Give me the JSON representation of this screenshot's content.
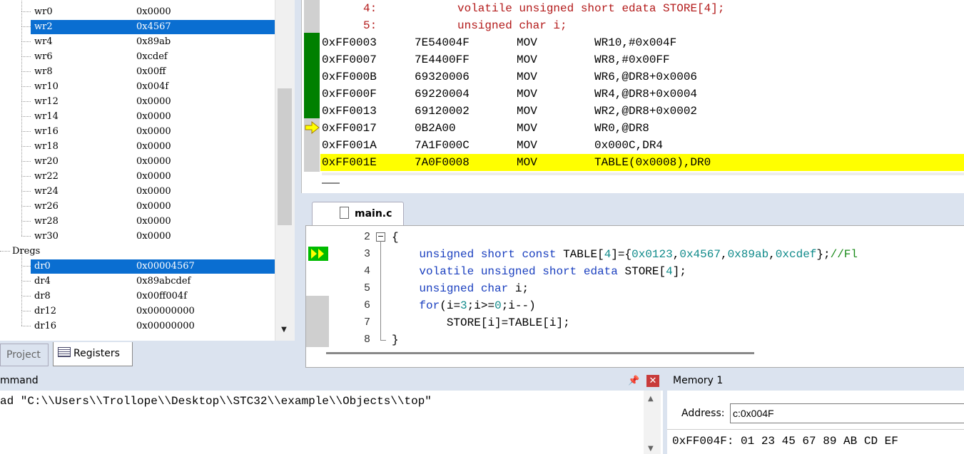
{
  "registers": {
    "wregs": [
      {
        "name": "wr0",
        "value": "0x0000"
      },
      {
        "name": "wr2",
        "value": "0x4567",
        "selected": true
      },
      {
        "name": "wr4",
        "value": "0x89ab"
      },
      {
        "name": "wr6",
        "value": "0xcdef"
      },
      {
        "name": "wr8",
        "value": "0x00ff"
      },
      {
        "name": "wr10",
        "value": "0x004f"
      },
      {
        "name": "wr12",
        "value": "0x0000"
      },
      {
        "name": "wr14",
        "value": "0x0000"
      },
      {
        "name": "wr16",
        "value": "0x0000"
      },
      {
        "name": "wr18",
        "value": "0x0000"
      },
      {
        "name": "wr20",
        "value": "0x0000"
      },
      {
        "name": "wr22",
        "value": "0x0000"
      },
      {
        "name": "wr24",
        "value": "0x0000"
      },
      {
        "name": "wr26",
        "value": "0x0000"
      },
      {
        "name": "wr28",
        "value": "0x0000"
      },
      {
        "name": "wr30",
        "value": "0x0000"
      }
    ],
    "dregs_label": "Dregs",
    "dregs": [
      {
        "name": "dr0",
        "value": "0x00004567",
        "selected": true
      },
      {
        "name": "dr4",
        "value": "0x89abcdef"
      },
      {
        "name": "dr8",
        "value": "0x00ff004f"
      },
      {
        "name": "dr12",
        "value": "0x00000000"
      },
      {
        "name": "dr16",
        "value": "0x00000000"
      }
    ]
  },
  "tabs": {
    "project": "Project",
    "registers": "Registers"
  },
  "disassembly": {
    "source": [
      {
        "num": "4:",
        "text": "volatile unsigned short edata STORE[4];"
      },
      {
        "num": "5:",
        "text": "unsigned char i;"
      }
    ],
    "lines": [
      {
        "addr": "0xFF0003",
        "bytes": "7E54004F",
        "op": "MOV",
        "args": "WR10,#0x004F"
      },
      {
        "addr": "0xFF0007",
        "bytes": "7E4400FF",
        "op": "MOV",
        "args": "WR8,#0x00FF"
      },
      {
        "addr": "0xFF000B",
        "bytes": "69320006",
        "op": "MOV",
        "args": "WR6,@DR8+0x0006"
      },
      {
        "addr": "0xFF000F",
        "bytes": "69220004",
        "op": "MOV",
        "args": "WR4,@DR8+0x0004"
      },
      {
        "addr": "0xFF0013",
        "bytes": "69120002",
        "op": "MOV",
        "args": "WR2,@DR8+0x0002"
      },
      {
        "addr": "0xFF0017",
        "bytes": "0B2A00",
        "op": "MOV",
        "args": "WR0,@DR8"
      },
      {
        "addr": "0xFF001A",
        "bytes": "7A1F000C",
        "op": "MOV",
        "args": "0x000C,DR4"
      },
      {
        "addr": "0xFF001E",
        "bytes": "7A0F0008",
        "op": "MOV",
        "args": "TABLE(0x0008),DR0"
      }
    ]
  },
  "editor": {
    "tab": "main.c",
    "lines": [
      {
        "num": "2",
        "text": "{"
      },
      {
        "num": "3",
        "text": "    unsigned short const TABLE[4]={0x0123,0x4567,0x89ab,0xcdef};//Fl"
      },
      {
        "num": "4",
        "text": "    volatile unsigned short edata STORE[4];"
      },
      {
        "num": "5",
        "text": "    unsigned char i;"
      },
      {
        "num": "6",
        "text": "    for(i=3;i>=0;i--)"
      },
      {
        "num": "7",
        "text": "        STORE[i]=TABLE[i];"
      },
      {
        "num": "8",
        "text": "}"
      }
    ]
  },
  "command": {
    "title": "mmand",
    "text": "ad \"C:\\\\Users\\\\Trollope\\\\Desktop\\\\STC32\\\\example\\\\Objects\\\\top\""
  },
  "memory": {
    "title": "Memory 1",
    "address_label": "Address:",
    "address_value": "c:0x004F",
    "data": "0xFF004F: 01 23 45 67 89 AB CD EF"
  },
  "colors": {
    "selection": "#0a6ed1",
    "current_line": "#ffff00",
    "executed": "#008000"
  }
}
